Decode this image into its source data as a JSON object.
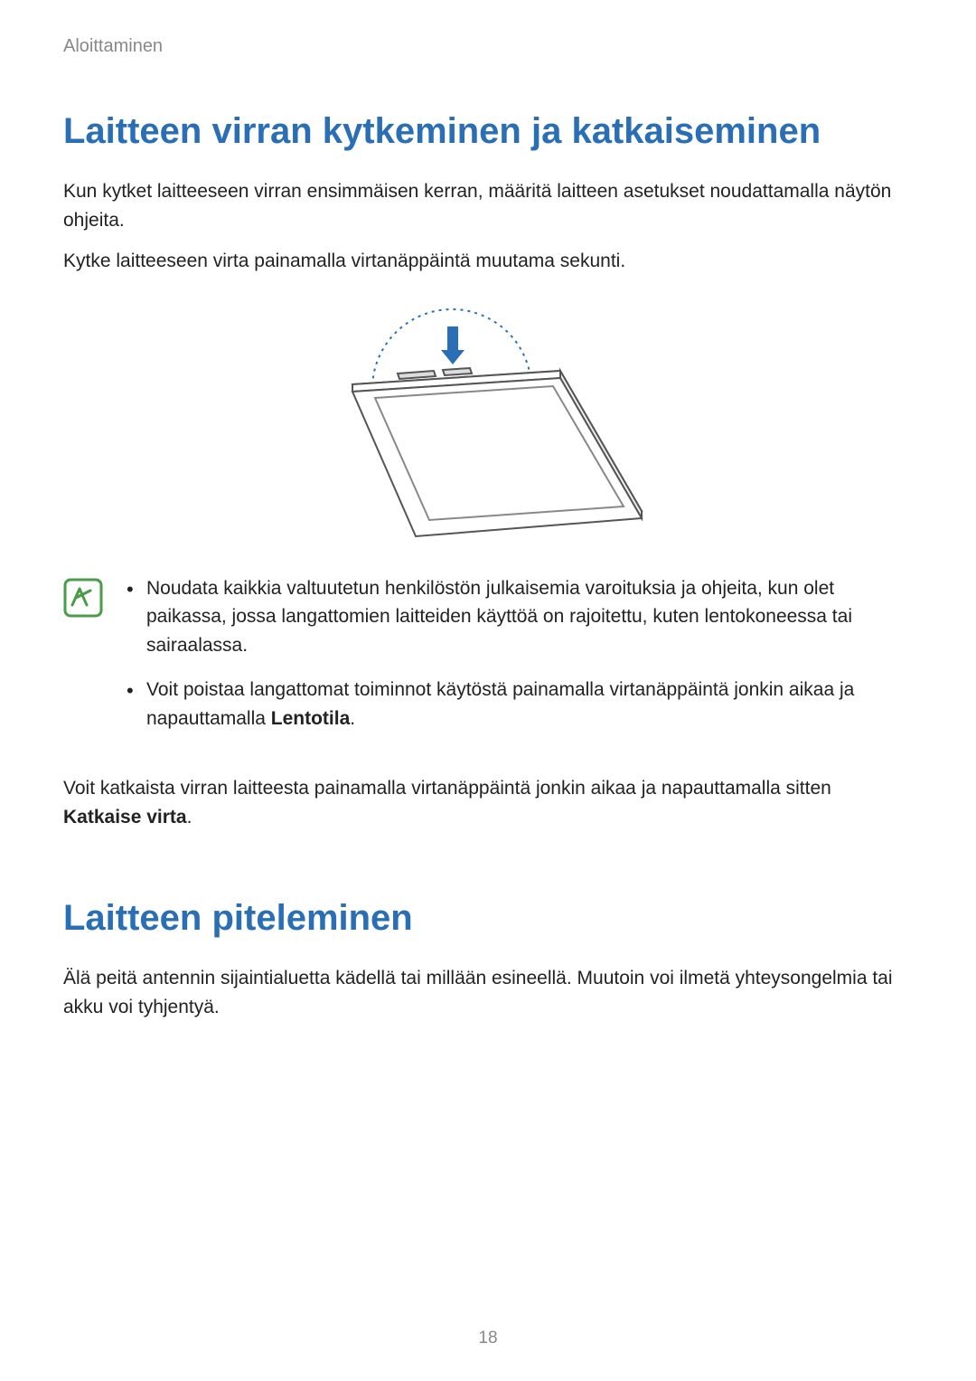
{
  "breadcrumb": "Aloittaminen",
  "section1": {
    "heading": "Laitteen virran kytkeminen ja katkaiseminen",
    "p1": "Kun kytket laitteeseen virran ensimmäisen kerran, määritä laitteen asetukset noudattamalla näytön ohjeita.",
    "p2": "Kytke laitteeseen virta painamalla virtanäppäintä muutama sekunti.",
    "note1": "Noudata kaikkia valtuutetun henkilöstön julkaisemia varoituksia ja ohjeita, kun olet paikassa, jossa langattomien laitteiden käyttöä on rajoitettu, kuten lentokoneessa tai sairaalassa.",
    "note2_a": "Voit poistaa langattomat toiminnot käytöstä painamalla virtanäppäintä jonkin aikaa ja napauttamalla ",
    "note2_bold": "Lentotila",
    "note2_b": ".",
    "p3_a": "Voit katkaista virran laitteesta painamalla virtanäppäintä jonkin aikaa ja napauttamalla sitten ",
    "p3_bold": "Katkaise virta",
    "p3_b": "."
  },
  "section2": {
    "heading": "Laitteen piteleminen",
    "p1": "Älä peitä antennin sijaintialuetta kädellä tai millään esineellä. Muutoin voi ilmetä yhteysongelmia tai akku voi tyhjentyä."
  },
  "pageNumber": "18"
}
